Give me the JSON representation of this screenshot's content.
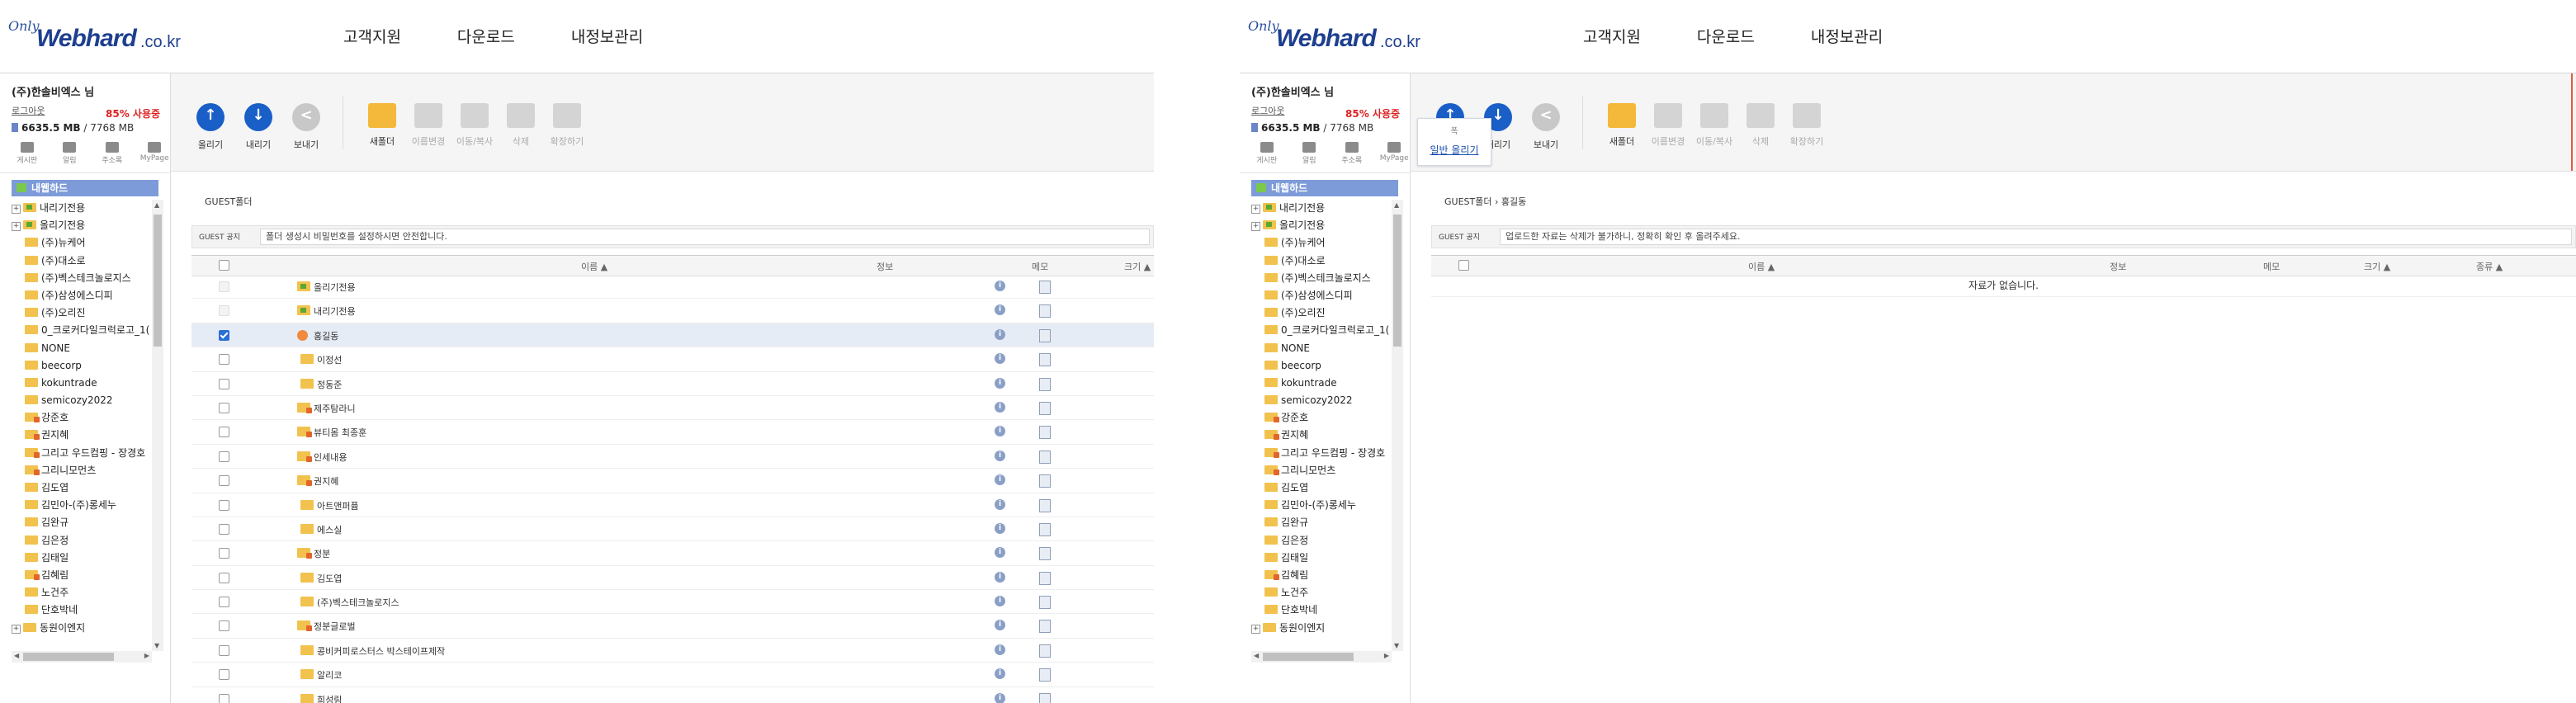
{
  "header": {
    "logo_only": "Only",
    "logo_main": "Webhard",
    "logo_sub": ".co.kr",
    "nav": [
      "고객지원",
      "다운로드",
      "내정보관리"
    ]
  },
  "user": {
    "name": "(주)한솔비엑스 님",
    "logout": "로그아웃",
    "usage_pct": "85% 사용중",
    "quota_used": "6635.5 MB",
    "quota_total": "/ 7768 MB"
  },
  "mini_tools": [
    "게시판",
    "알림",
    "주소록",
    "MyPage"
  ],
  "tree": {
    "root": "내웹하드",
    "items": [
      {
        "label": "내리기전용",
        "type": "arrow",
        "depth": 0,
        "toggle": "+"
      },
      {
        "label": "올리기전용",
        "type": "arrow",
        "depth": 0,
        "toggle": "+"
      },
      {
        "label": "(주)뉴케어",
        "type": "plain",
        "depth": 1
      },
      {
        "label": "(주)대소로",
        "type": "plain",
        "depth": 1
      },
      {
        "label": "(주)벡스테크놀로지스",
        "type": "plain",
        "depth": 1
      },
      {
        "label": "(주)삼성에스디피",
        "type": "plain",
        "depth": 1
      },
      {
        "label": "(주)오리진",
        "type": "plain",
        "depth": 1
      },
      {
        "label": "0_크로커다일크럭로고_1(",
        "type": "plain",
        "depth": 1
      },
      {
        "label": "NONE",
        "type": "plain",
        "depth": 1
      },
      {
        "label": "beecorp",
        "type": "plain",
        "depth": 1
      },
      {
        "label": "kokuntrade",
        "type": "plain",
        "depth": 1
      },
      {
        "label": "semicozy2022",
        "type": "plain",
        "depth": 1
      },
      {
        "label": "강준호",
        "type": "lock",
        "depth": 1
      },
      {
        "label": "권지혜",
        "type": "lock",
        "depth": 1
      },
      {
        "label": "그리고 우드컴핑 - 장경호",
        "type": "lock",
        "depth": 1
      },
      {
        "label": "그리니모먼츠",
        "type": "lock",
        "depth": 1
      },
      {
        "label": "김도엽",
        "type": "plain",
        "depth": 1
      },
      {
        "label": "김민아-(주)롱세누",
        "type": "plain",
        "depth": 1
      },
      {
        "label": "김완규",
        "type": "plain",
        "depth": 1
      },
      {
        "label": "김은정",
        "type": "plain",
        "depth": 1
      },
      {
        "label": "김태일",
        "type": "plain",
        "depth": 1
      },
      {
        "label": "김혜림",
        "type": "lock",
        "depth": 1
      },
      {
        "label": "노건주",
        "type": "plain",
        "depth": 1
      },
      {
        "label": "단호박네",
        "type": "plain",
        "depth": 1
      },
      {
        "label": "동원이엔지",
        "type": "plain",
        "depth": 0,
        "toggle": "+"
      }
    ]
  },
  "toolbar": {
    "upload": "올리기",
    "download": "내리기",
    "share": "보내기",
    "new_folder": "새폴더",
    "rename": "이름변경",
    "move_copy": "이동/복사",
    "delete": "삭제",
    "archive": "확장하기"
  },
  "left_content": {
    "breadcrumb": "GUEST폴더",
    "guest_label": "GUEST 공지",
    "guest_notice": "폴더 생성시 비밀번호를 설정하시면 안전합니다.",
    "columns": {
      "name": "이름 ▲",
      "info": "정보",
      "memo": "메모",
      "size": "크기 ▲"
    },
    "rows": [
      {
        "name": "올리기전용",
        "icon": "arrow",
        "checked": false,
        "disabled": true
      },
      {
        "name": "내리기전용",
        "icon": "arrow",
        "checked": false,
        "disabled": true
      },
      {
        "name": "홍길동",
        "icon": "user",
        "checked": true,
        "disabled": false
      },
      {
        "name": "이정선",
        "icon": "plain",
        "checked": false,
        "disabled": false
      },
      {
        "name": "정동준",
        "icon": "plain",
        "checked": false,
        "disabled": false
      },
      {
        "name": "제주탐라니",
        "icon": "lock",
        "checked": false,
        "disabled": false
      },
      {
        "name": "뷰티몸 최종훈",
        "icon": "lock",
        "checked": false,
        "disabled": false
      },
      {
        "name": "인세내용",
        "icon": "lock",
        "checked": false,
        "disabled": false
      },
      {
        "name": "권지혜",
        "icon": "lock",
        "checked": false,
        "disabled": false
      },
      {
        "name": "아트앤퍼퓸",
        "icon": "plain",
        "checked": false,
        "disabled": false
      },
      {
        "name": "에스실",
        "icon": "plain",
        "checked": false,
        "disabled": false
      },
      {
        "name": "정분",
        "icon": "lock",
        "checked": false,
        "disabled": false
      },
      {
        "name": "김도엽",
        "icon": "plain",
        "checked": false,
        "disabled": false
      },
      {
        "name": "(주)벡스테크놀로지스",
        "icon": "plain",
        "checked": false,
        "disabled": false
      },
      {
        "name": "정분글로벌",
        "icon": "lock",
        "checked": false,
        "disabled": false
      },
      {
        "name": "콩비커피로스터스 박스테이프제작",
        "icon": "plain",
        "checked": false,
        "disabled": false
      },
      {
        "name": "알리코",
        "icon": "plain",
        "checked": false,
        "disabled": false
      },
      {
        "name": "희성림",
        "icon": "plain",
        "checked": false,
        "disabled": false
      }
    ]
  },
  "right_content": {
    "breadcrumb": "GUEST폴더 › 홍길동",
    "guest_label": "GUEST 공지",
    "guest_notice": "업로드한 자료는 삭제가 불가하니, 정확히 확인 후 올려주세요.",
    "columns": {
      "name": "이름 ▲",
      "info": "정보",
      "memo": "메모",
      "size": "크기 ▲",
      "type": "종류 ▲"
    },
    "empty": "자료가 없습니다.",
    "tooltip_caption": "폭",
    "tooltip_link": "일반 올리기"
  },
  "colors": {
    "accent": "#1a5fc7",
    "tree_header": "#7d9bd8",
    "usage": "#dd2222"
  }
}
